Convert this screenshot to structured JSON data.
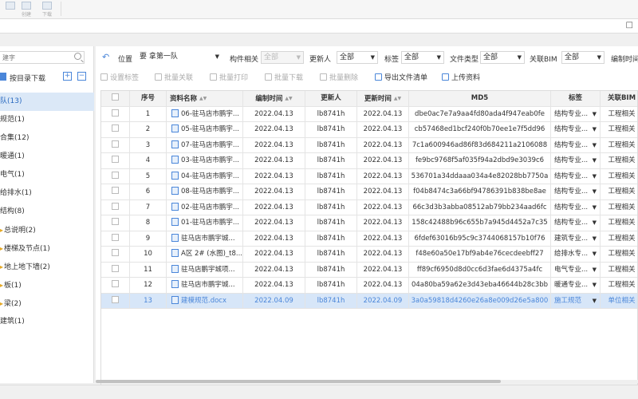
{
  "ribbon": {
    "btn1_label": "",
    "btn2_label": "创建",
    "btn3_label": "下载"
  },
  "window": {
    "restore_glyph": "□"
  },
  "sidebar": {
    "search_placeholder": "建字",
    "download_label": "按目录下载",
    "add_glyph": "+",
    "collapse_glyph": "−",
    "items": [
      {
        "label": "队(13)",
        "active": true
      },
      {
        "label": "规范(1)"
      },
      {
        "label": "合集(12)"
      },
      {
        "label": "暖通(1)"
      },
      {
        "label": "电气(1)"
      },
      {
        "label": "给排水(1)"
      },
      {
        "label": "结构(8)"
      },
      {
        "label": "总说明(2)",
        "folder": true
      },
      {
        "label": "楼梯及节点(1)",
        "folder": true
      },
      {
        "label": "地上地下墙(2)",
        "folder": true
      },
      {
        "label": "板(1)",
        "folder": true
      },
      {
        "label": "梁(2)",
        "folder": true
      },
      {
        "label": "建筑(1)"
      }
    ]
  },
  "filterbar": {
    "location_label": "位置",
    "location_value": "要 拿第一队",
    "component_label": "构件相关",
    "component_value": "全部",
    "updater_label": "更新人",
    "updater_value": "全部",
    "tag_label": "标签",
    "tag_value": "全部",
    "filetype_label": "文件类型",
    "filetype_value": "全部",
    "bim_label": "关联BIM",
    "bim_value": "全部",
    "edit_time_label": "编制时间"
  },
  "toolbar": {
    "set_tag": "设置标签",
    "batch_link": "批量关联",
    "batch_print": "批量打印",
    "batch_download": "批量下载",
    "batch_delete": "批量删除",
    "export_list": "导出文件清单",
    "upload": "上传资料"
  },
  "table": {
    "headers": {
      "seq": "序号",
      "name": "资料名称",
      "edit_time": "编制时间",
      "updater": "更新人",
      "update_time": "更新时间",
      "md5": "MD5",
      "tag": "标签",
      "bim": "关联BIM"
    },
    "rows": [
      {
        "seq": "1",
        "name": "06-驻马店市鹏宇...",
        "edit_time": "2022.04.13",
        "updater": "lb8741h",
        "update_time": "2022.04.13",
        "md5": "dbe0ac7e7a9aa4fd80ada4f947eab0fe",
        "tag": "结构专业...",
        "bim": "工程相关"
      },
      {
        "seq": "2",
        "name": "05-驻马店市鹏宇...",
        "edit_time": "2022.04.13",
        "updater": "lb8741h",
        "update_time": "2022.04.13",
        "md5": "cb57468ed1bcf240f0b70ee1e7f5dd96",
        "tag": "结构专业...",
        "bim": "工程相关"
      },
      {
        "seq": "3",
        "name": "07-驻马店市鹏宇...",
        "edit_time": "2022.04.13",
        "updater": "lb8741h",
        "update_time": "2022.04.13",
        "md5": "7c1a600946ad86f83d684211a2106088",
        "tag": "结构专业...",
        "bim": "工程相关"
      },
      {
        "seq": "4",
        "name": "03-驻马店市鹏宇...",
        "edit_time": "2022.04.13",
        "updater": "lb8741h",
        "update_time": "2022.04.13",
        "md5": "fe9bc9768f5af035f94a2dbd9e3039c6",
        "tag": "结构专业...",
        "bim": "工程相关"
      },
      {
        "seq": "5",
        "name": "04-驻马店市鹏宇...",
        "edit_time": "2022.04.13",
        "updater": "lb8741h",
        "update_time": "2022.04.13",
        "md5": "536701a34ddaaa034a4e82028bb7750a",
        "tag": "结构专业...",
        "bim": "工程相关"
      },
      {
        "seq": "6",
        "name": "08-驻马店市鹏宇...",
        "edit_time": "2022.04.13",
        "updater": "lb8741h",
        "update_time": "2022.04.13",
        "md5": "f04b8474c3a66bf94786391b838be8ae",
        "tag": "结构专业...",
        "bim": "工程相关"
      },
      {
        "seq": "7",
        "name": "02-驻马店市鹏宇...",
        "edit_time": "2022.04.13",
        "updater": "lb8741h",
        "update_time": "2022.04.13",
        "md5": "66c3d3b3abba08512ab79bb234aad6fc",
        "tag": "结构专业...",
        "bim": "工程相关"
      },
      {
        "seq": "8",
        "name": "01-驻马店市鹏宇...",
        "edit_time": "2022.04.13",
        "updater": "lb8741h",
        "update_time": "2022.04.13",
        "md5": "158c42488b96c655b7a945d4452a7c35",
        "tag": "结构专业...",
        "bim": "工程相关"
      },
      {
        "seq": "9",
        "name": "驻马店市鹏宇城...",
        "edit_time": "2022.04.13",
        "updater": "lb8741h",
        "update_time": "2022.04.13",
        "md5": "6fdef63016b95c9c3744068157b10f76",
        "tag": "建筑专业...",
        "bim": "工程相关"
      },
      {
        "seq": "10",
        "name": "A区 2# (水图)_t8...",
        "edit_time": "2022.04.13",
        "updater": "lb8741h",
        "update_time": "2022.04.13",
        "md5": "f48e60a50e17bf9ab4e76cecdeebff27",
        "tag": "给排水专...",
        "bim": "工程相关"
      },
      {
        "seq": "11",
        "name": "驻马店鹏宇城项...",
        "edit_time": "2022.04.13",
        "updater": "lb8741h",
        "update_time": "2022.04.13",
        "md5": "ff89cf6950d8d0cc6d3fae6d4375a4fc",
        "tag": "电气专业...",
        "bim": "工程相关"
      },
      {
        "seq": "12",
        "name": "驻马店市鹏宇城...",
        "edit_time": "2022.04.13",
        "updater": "lb8741h",
        "update_time": "2022.04.13",
        "md5": "04a80ba59a62e3d43eba46644b28c3bb",
        "tag": "暖通专业...",
        "bim": "工程相关"
      },
      {
        "seq": "13",
        "name": "建模规范.docx",
        "edit_time": "2022.04.09",
        "updater": "lb8741h",
        "update_time": "2022.04.09",
        "md5": "3a0a59818d4260e26a8e009d26e5a800",
        "tag": "施工规范",
        "bim": "单位相关",
        "selected": true
      }
    ]
  },
  "colors": {
    "accent": "#4a86d9",
    "selected_row": "#d7e6f8",
    "active_tree": "#dbe8f7"
  }
}
